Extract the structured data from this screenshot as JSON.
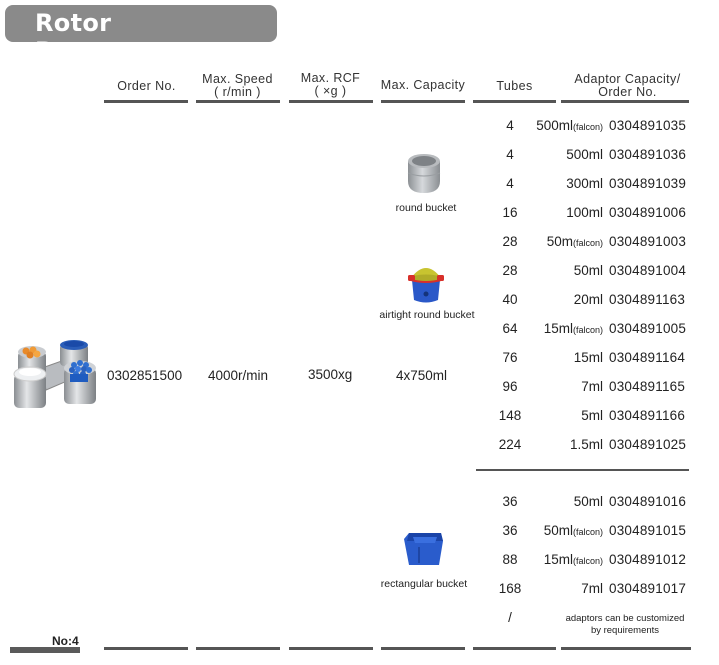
{
  "title": "Rotor Parameters",
  "headers": {
    "order_no": "Order No.",
    "max_speed_line1": "Max. Speed",
    "max_speed_line2": "( r/min )",
    "max_rcf_line1": "Max. RCF",
    "max_rcf_line2": "( ×g )",
    "max_capacity": "Max. Capacity",
    "tubes": "Tubes",
    "adaptor_line1": "Adaptor Capacity/",
    "adaptor_line2": "Order No."
  },
  "rotor": {
    "order_no": "0302851500",
    "max_speed": "4000r/min",
    "max_rcf": "3500xg",
    "max_capacity": "4x750ml"
  },
  "buckets": [
    {
      "label": "round bucket",
      "icon": "round-bucket-icon"
    },
    {
      "label": "airtight round bucket",
      "icon": "airtight-round-bucket-icon"
    },
    {
      "label": "rectangular bucket",
      "icon": "rectangular-bucket-icon"
    }
  ],
  "adaptors_round": [
    {
      "tubes": "4",
      "capacity": "500ml",
      "suffix": "(falcon)",
      "order_no": "0304891035"
    },
    {
      "tubes": "4",
      "capacity": "500ml",
      "suffix": "",
      "order_no": "0304891036"
    },
    {
      "tubes": "4",
      "capacity": "300ml",
      "suffix": "",
      "order_no": "0304891039"
    },
    {
      "tubes": "16",
      "capacity": "100ml",
      "suffix": "",
      "order_no": "0304891006"
    },
    {
      "tubes": "28",
      "capacity": "50m",
      "suffix": "(falcon)",
      "order_no": "0304891003"
    },
    {
      "tubes": "28",
      "capacity": "50ml",
      "suffix": "",
      "order_no": "0304891004"
    },
    {
      "tubes": "40",
      "capacity": "20ml",
      "suffix": "",
      "order_no": "0304891163"
    },
    {
      "tubes": "64",
      "capacity": "15ml",
      "suffix": "(falcon)",
      "order_no": "0304891005"
    },
    {
      "tubes": "76",
      "capacity": "15ml",
      "suffix": "",
      "order_no": "0304891164"
    },
    {
      "tubes": "96",
      "capacity": "7ml",
      "suffix": "",
      "order_no": "0304891165"
    },
    {
      "tubes": "148",
      "capacity": "5ml",
      "suffix": "",
      "order_no": "0304891166"
    },
    {
      "tubes": "224",
      "capacity": "1.5ml",
      "suffix": "",
      "order_no": "0304891025"
    }
  ],
  "adaptors_rect": [
    {
      "tubes": "36",
      "capacity": "50ml",
      "suffix": "",
      "order_no": "0304891016"
    },
    {
      "tubes": "36",
      "capacity": "50ml",
      "suffix": "(falcon)",
      "order_no": "0304891015"
    },
    {
      "tubes": "88",
      "capacity": "15ml",
      "suffix": "(falcon)",
      "order_no": "0304891012"
    },
    {
      "tubes": "168",
      "capacity": "7ml",
      "suffix": "",
      "order_no": "0304891017"
    }
  ],
  "custom_row": {
    "tubes": "/",
    "note_line1": "adaptors can be customized",
    "note_line2": "by requirements"
  },
  "footer": {
    "page_label": "No:4"
  }
}
